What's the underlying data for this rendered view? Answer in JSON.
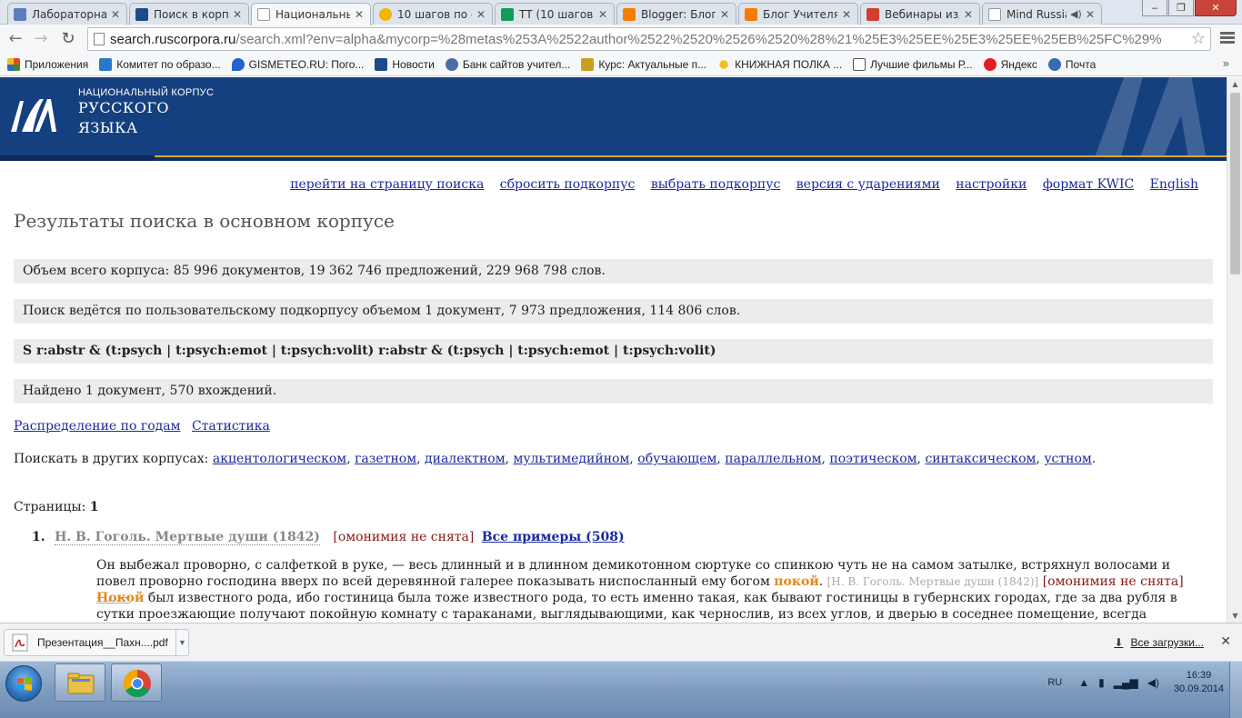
{
  "browser": {
    "tabs": [
      {
        "title": "Лабораторная",
        "favicon_color": "#5a7fb8"
      },
      {
        "title": "Поиск в корпу",
        "favicon_color": "#1c4a8a"
      },
      {
        "title": "Национальны",
        "favicon_color": "#ffffff",
        "active": true
      },
      {
        "title": "10 шагов по с",
        "favicon_color": "#f4b400"
      },
      {
        "title": "ТТ (10 шагов)",
        "favicon_color": "#0f9d58"
      },
      {
        "title": "Blogger: Блог",
        "favicon_color": "#f57d00"
      },
      {
        "title": "Блог Учителя",
        "favicon_color": "#f57d00"
      },
      {
        "title": "Вебинары изд",
        "favicon_color": "#d23f31"
      },
      {
        "title": "Mind Russia",
        "favicon_color": "#ffffff"
      }
    ],
    "tab_close": "✕",
    "url_host": "search.ruscorpora.ru",
    "url_path": "/search.xml?env=alpha&mycorp=%28metas%253A%2522author%2522%2520%2526%2520%28%21%25E3%25EE%25E3%25EE%25EB%25FC%29%",
    "bookmarks": [
      {
        "label": "Приложения",
        "icon_color": "#e04a2a"
      },
      {
        "label": "Комитет по образо...",
        "icon_color": "#2a78c8"
      },
      {
        "label": "GISMETEO.RU: Пого...",
        "icon_color": "#2266cc"
      },
      {
        "label": "Новости",
        "icon_color": "#1c4a8a"
      },
      {
        "label": "Банк сайтов учител...",
        "icon_color": "#4a6fa8"
      },
      {
        "label": "Курс: Актуальные п...",
        "icon_color": "#c8a020"
      },
      {
        "label": "КНИЖНАЯ ПОЛКА ...",
        "icon_color": "#f0c020"
      },
      {
        "label": "Лучшие фильмы Р...",
        "icon_color": "#555555"
      },
      {
        "label": "Яндекс",
        "icon_color": "#e02020"
      },
      {
        "label": "Почта",
        "icon_color": "#3a6ab0"
      }
    ],
    "bookmarks_more": "»"
  },
  "site": {
    "logo_line1": "НАЦИОНАЛЬНЫЙ КОРПУС",
    "logo_line2": "РУССКОГО",
    "logo_line3": "ЯЗЫКА",
    "banner_color": "#15407f",
    "accent_gold": "#d6a628"
  },
  "nav_links": [
    "перейти на страницу поиска",
    "сбросить подкорпус",
    "выбрать подкорпус",
    "версия с ударениями",
    "настройки",
    "формат KWIC",
    "English"
  ],
  "page_title": "Результаты поиска в основном корпусе",
  "info": {
    "corpus_size": "Объем всего корпуса: 85 996 документов, 19 362 746 предложений, 229 968 798 слов.",
    "subcorpus": "Поиск ведётся по пользовательскому подкорпусу объемом 1 документ, 7 973 предложения, 114 806 слов.",
    "query": "S  r:abstr & (t:psych | t:psych:emot | t:psych:volit)  r:abstr & (t:psych | t:psych:emot | t:psych:volit)",
    "found": "Найдено 1 документ, 570 вхождений."
  },
  "distribution_links": [
    "Распределение по годам",
    "Статистика"
  ],
  "other_corpora": {
    "label": "Поискать в других корпусах:",
    "links": [
      "акцентологическом",
      "газетном",
      "диалектном",
      "мультимедийном",
      "обучающем",
      "параллельном",
      "поэтическом",
      "синтаксическом",
      "устном"
    ]
  },
  "pages": {
    "label": "Страницы:",
    "current": "1"
  },
  "results": [
    {
      "num": "1.",
      "doc_title": "Н. В. Гоголь. Мертвые души (1842)",
      "omonimia": "омонимия не снята",
      "all_examples": "Все примеры (508)",
      "snippet1_a": "Он выбежал проворно, с салфеткой в руке, — весь длинный и в длинном демикотонном сюртуке со спинкою чуть не на самом затылке, встряхнул волосами и повел проворно господина вверх по всей деревянной галерее показывать ниспосланный ему богом",
      "snippet1_hl": "покой",
      "snippet1_src": "[Н. В. Гоголь. Мертвые души (1842)]",
      "snippet1_arrows": "←…→",
      "snippet2_hl": "Покой",
      "snippet2_rest": "был известного рода, ибо гостиница была тоже известного рода, то есть именно такая, как бывают гостиницы в губернских городах, где за два рубля в сутки проезжающие получают покойную комнату с тараканами, выглядывающими, как чернослив, из всех углов, и дверью в соседнее помещение, всегда заставленною комодом, где"
    }
  ],
  "downloads": {
    "file": "Презентация__Пахн....pdf",
    "all_label": "Все загрузки..."
  },
  "taskbar": {
    "lang": "RU",
    "time": "16:39",
    "date": "30.09.2014"
  }
}
